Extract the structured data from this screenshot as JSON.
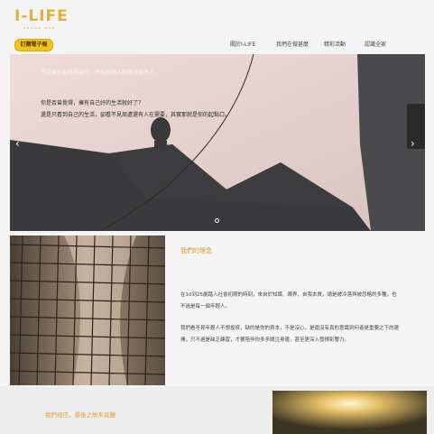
{
  "header": {
    "logo": "I-LIFE",
    "logo_sub": "EBOOK WEB",
    "ebook_button": "訂購電子報",
    "nav": [
      "關於I-LIFE",
      "我們在做甚麼",
      "精彩活動",
      "認識全家"
    ]
  },
  "hero": {
    "title": "不是擁有最棒的身分，才能對他人說教付出大人",
    "line1": "你是否曾覺得，擁有自己好的生活就好了？",
    "line2": "還是只看到自己的生活，卻看不見周遭還有人在需要，其實那就是你的起點口。",
    "slides": 1
  },
  "about": {
    "title": "我們的理念",
    "p1": "在10到25歲踏入社會初期的時刻，來自於知識、眼界、自我本質，總是被冷落與被忽略的多種，也",
    "p1b": "不過是每一個年輕人。",
    "p2": "我們看不見年輕人不想投資，缺的是你的資本，不是沒心，是還沒有真的意識到何者是重要之下的選",
    "p2b": "擇，只不過是缺乏練習，才要陪伴你多多關注身邊，甚至更深入發揮影響力。"
  },
  "bottom": {
    "text": "我們相信，最後之故來具體"
  },
  "colors": {
    "accent": "#e2b13c",
    "button_bg": "#f0c419",
    "title_orange": "#d99a2b"
  }
}
